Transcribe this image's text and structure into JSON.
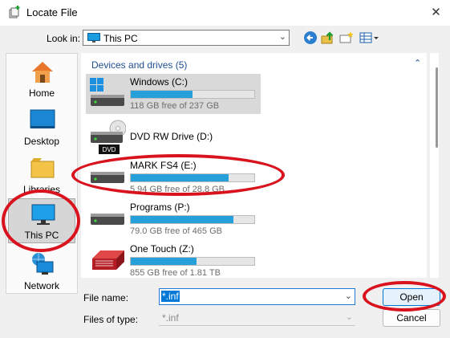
{
  "window": {
    "title": "Locate File",
    "close_glyph": "✕"
  },
  "lookin": {
    "label": "Look in:",
    "value": "This PC"
  },
  "places": [
    {
      "label": "Home",
      "icon": "home-icon"
    },
    {
      "label": "Desktop",
      "icon": "desktop-icon"
    },
    {
      "label": "Libraries",
      "icon": "libraries-icon"
    },
    {
      "label": "This PC",
      "icon": "this-pc-icon",
      "selected": true
    },
    {
      "label": "Network",
      "icon": "network-icon"
    }
  ],
  "filelist": {
    "group_header": "Devices and drives (5)",
    "drives": [
      {
        "name": "Windows  (C:)",
        "free": "118 GB free of 237 GB",
        "used_fraction": 0.5,
        "selected": true
      },
      {
        "name": "DVD RW Drive (D:)",
        "badge": "DVD"
      },
      {
        "name": "MARK FS4 (E:)",
        "free": "5.94 GB free of 28.8 GB",
        "used_fraction": 0.79
      },
      {
        "name": "Programs (P:)",
        "free": "79.0 GB free of 465 GB",
        "used_fraction": 0.83
      },
      {
        "name": "One Touch (Z:)",
        "free": "855 GB free of 1.81 TB",
        "used_fraction": 0.53
      }
    ]
  },
  "bottom": {
    "filename_label": "File name:",
    "filename_value": "*.inf",
    "filetype_label": "Files of type:",
    "filetype_value": "*.inf",
    "open_label": "Open",
    "cancel_label": "Cancel"
  },
  "colors": {
    "accent": "#0078d7",
    "usage_bar": "#26a0da",
    "annotation": "#d9131d"
  }
}
